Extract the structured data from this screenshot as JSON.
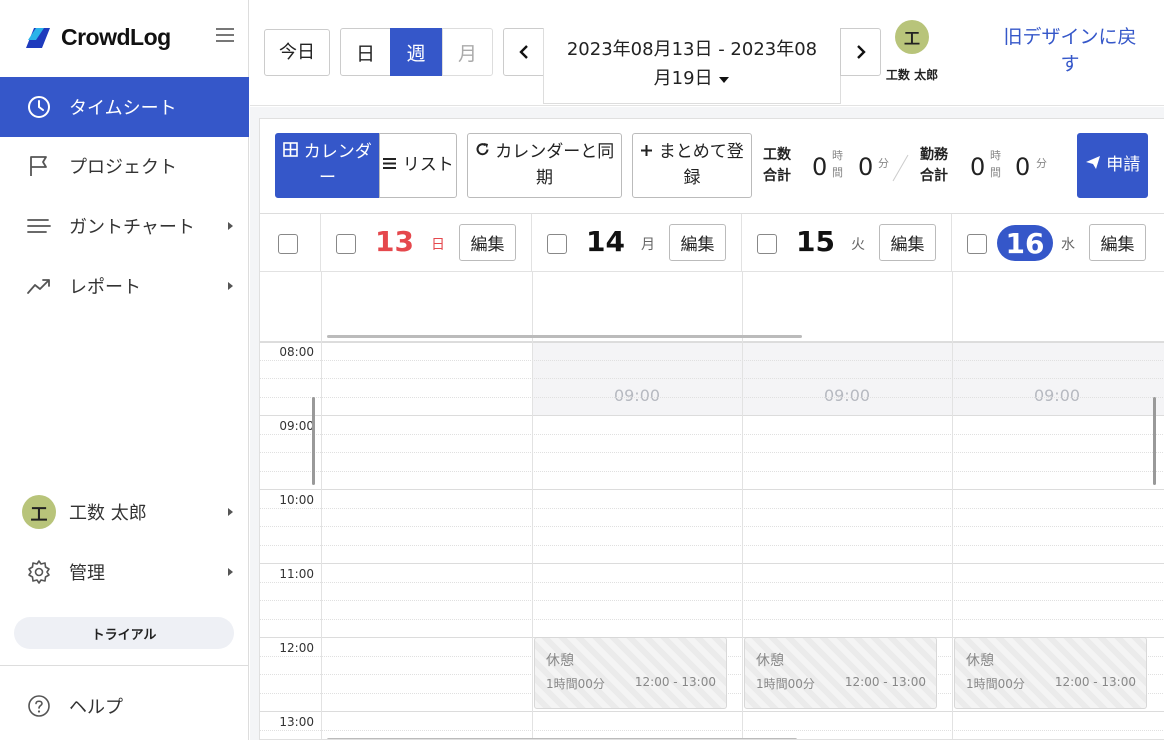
{
  "sidebar": {
    "logo_text": "CrowdLog",
    "menu_icon": "hamburger-icon",
    "items": [
      {
        "label": "タイムシート",
        "icon": "clock-icon",
        "active": true
      },
      {
        "label": "プロジェクト",
        "icon": "flag-icon"
      },
      {
        "label": "ガントチャート",
        "icon": "gantt-lines-icon"
      },
      {
        "label": "レポート",
        "icon": "trend-up-icon"
      }
    ],
    "user": {
      "avatar_char": "工",
      "name": "工数 太郎"
    },
    "admin_label": "管理",
    "trial_label": "トライアル",
    "help_label": "ヘルプ"
  },
  "header": {
    "today_label": "今日",
    "view_day": "日",
    "view_week": "週",
    "view_month": "月",
    "date_range_line1": "2023年08月13日 - 2023年08",
    "date_range_line2": "月19日",
    "user_avatar_char": "工",
    "user_name": "工数 太郎",
    "old_design_label": "旧デザインに戻す"
  },
  "toolbar": {
    "calendar_label": "カレンダー",
    "list_label": "リスト",
    "sync_label": "カレンダーと同期",
    "bulk_label": "まとめて登録",
    "work_total_label_1": "工数",
    "work_total_label_2": "合計",
    "work_hours": "0",
    "work_minutes": "0",
    "duty_total_label_1": "勤務",
    "duty_total_label_2": "合計",
    "duty_hours": "0",
    "duty_minutes": "0",
    "unit_hour_1": "時",
    "unit_hour_2": "間",
    "unit_minute": "分",
    "submit_label": "申請"
  },
  "calendar": {
    "edit_label": "編集",
    "days": [
      {
        "num": "13",
        "dow": "日",
        "color": "#e5484d"
      },
      {
        "num": "14",
        "dow": "月"
      },
      {
        "num": "15",
        "dow": "火"
      },
      {
        "num": "16",
        "dow": "水",
        "today": true
      }
    ],
    "hours": [
      "08:00",
      "09:00",
      "10:00",
      "11:00",
      "12:00",
      "13:00"
    ],
    "work_start_marker": "09:00",
    "break_block": {
      "title": "休憩",
      "duration": "1時間00分",
      "range": "12:00 - 13:00"
    }
  },
  "colors": {
    "accent": "#3557c9",
    "sunday": "#e5484d",
    "avatar": "#b8c47a"
  }
}
